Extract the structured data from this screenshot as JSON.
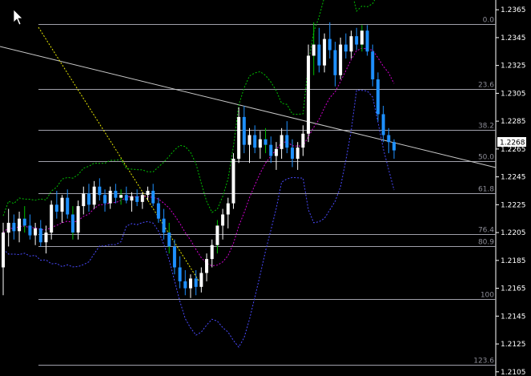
{
  "chart_data": {
    "type": "candlestick",
    "y_ticks": [
      "1.2365",
      "1.2345",
      "1.2325",
      "1.2305",
      "1.2285",
      "1.2265",
      "1.2245",
      "1.2225",
      "1.2205",
      "1.2185",
      "1.2165",
      "1.2145",
      "1.2125",
      "1.2105"
    ],
    "ylim": [
      1.2102,
      1.2372
    ],
    "current_price": "1.2268",
    "fibonacci": {
      "levels": [
        {
          "label": "0.0",
          "price": 1.2355
        },
        {
          "label": "23.6",
          "price": 1.2308
        },
        {
          "label": "38.2",
          "price": 1.2279
        },
        {
          "label": "50.0",
          "price": 1.2256
        },
        {
          "label": "61.8",
          "price": 1.2233
        },
        {
          "label": "76.4",
          "price": 1.2204
        },
        {
          "label": "80.9",
          "price": 1.2195
        },
        {
          "label": "100",
          "price": 1.2157
        },
        {
          "label": "123.6",
          "price": 1.211
        }
      ]
    },
    "candles": [
      [
        1.218,
        1.2212,
        1.216,
        1.2205
      ],
      [
        1.2205,
        1.2222,
        1.2195,
        1.2212
      ],
      [
        1.2212,
        1.2218,
        1.22,
        1.2206
      ],
      [
        1.2206,
        1.222,
        1.2198,
        1.2215
      ],
      [
        1.2215,
        1.2224,
        1.2205,
        1.221
      ],
      [
        1.221,
        1.2218,
        1.22,
        1.2203
      ],
      [
        1.2203,
        1.2212,
        1.2196,
        1.2208
      ],
      [
        1.2208,
        1.2214,
        1.2195,
        1.2198
      ],
      [
        1.2198,
        1.221,
        1.219,
        1.2205
      ],
      [
        1.2205,
        1.2228,
        1.22,
        1.2225
      ],
      [
        1.2225,
        1.2235,
        1.2215,
        1.222
      ],
      [
        1.222,
        1.2232,
        1.2212,
        1.223
      ],
      [
        1.223,
        1.2236,
        1.2215,
        1.2218
      ],
      [
        1.2218,
        1.2224,
        1.22,
        1.2205
      ],
      [
        1.2205,
        1.2228,
        1.22,
        1.2224
      ],
      [
        1.2224,
        1.2238,
        1.2218,
        1.2233
      ],
      [
        1.2233,
        1.224,
        1.222,
        1.2225
      ],
      [
        1.2225,
        1.2242,
        1.2222,
        1.2238
      ],
      [
        1.2238,
        1.2244,
        1.2228,
        1.2232
      ],
      [
        1.2232,
        1.2236,
        1.222,
        1.2226
      ],
      [
        1.2226,
        1.2238,
        1.2222,
        1.2235
      ],
      [
        1.2235,
        1.224,
        1.2226,
        1.223
      ],
      [
        1.223,
        1.2236,
        1.2225,
        1.2232
      ],
      [
        1.2232,
        1.2238,
        1.2226,
        1.2228
      ],
      [
        1.2228,
        1.2234,
        1.222,
        1.2231
      ],
      [
        1.2231,
        1.2236,
        1.2224,
        1.2227
      ],
      [
        1.2227,
        1.2234,
        1.2222,
        1.2232
      ],
      [
        1.2232,
        1.2238,
        1.2228,
        1.2235
      ],
      [
        1.2235,
        1.224,
        1.2224,
        1.2226
      ],
      [
        1.2226,
        1.223,
        1.2212,
        1.2215
      ],
      [
        1.2215,
        1.2222,
        1.22,
        1.2205
      ],
      [
        1.2205,
        1.2212,
        1.219,
        1.2195
      ],
      [
        1.2195,
        1.22,
        1.2175,
        1.218
      ],
      [
        1.218,
        1.2188,
        1.2165,
        1.217
      ],
      [
        1.217,
        1.2178,
        1.216,
        1.2165
      ],
      [
        1.2165,
        1.2175,
        1.2158,
        1.2172
      ],
      [
        1.2172,
        1.2178,
        1.216,
        1.2166
      ],
      [
        1.2166,
        1.218,
        1.2162,
        1.2176
      ],
      [
        1.2176,
        1.219,
        1.217,
        1.2186
      ],
      [
        1.2186,
        1.22,
        1.218,
        1.2196
      ],
      [
        1.2196,
        1.2214,
        1.219,
        1.221
      ],
      [
        1.221,
        1.2222,
        1.22,
        1.2218
      ],
      [
        1.2218,
        1.223,
        1.2208,
        1.2226
      ],
      [
        1.2226,
        1.2262,
        1.2222,
        1.2258
      ],
      [
        1.2258,
        1.2295,
        1.2255,
        1.2288
      ],
      [
        1.2288,
        1.2296,
        1.2262,
        1.2268
      ],
      [
        1.2268,
        1.228,
        1.2255,
        1.2275
      ],
      [
        1.2275,
        1.2282,
        1.2262,
        1.2266
      ],
      [
        1.2266,
        1.2278,
        1.2258,
        1.2272
      ],
      [
        1.2272,
        1.228,
        1.2262,
        1.2268
      ],
      [
        1.2268,
        1.2274,
        1.2255,
        1.226
      ],
      [
        1.226,
        1.227,
        1.225,
        1.2265
      ],
      [
        1.2265,
        1.228,
        1.2258,
        1.2275
      ],
      [
        1.2275,
        1.2285,
        1.2262,
        1.2266
      ],
      [
        1.2266,
        1.2272,
        1.2252,
        1.2258
      ],
      [
        1.2258,
        1.227,
        1.225,
        1.2266
      ],
      [
        1.2266,
        1.2282,
        1.226,
        1.2276
      ],
      [
        1.2276,
        1.234,
        1.227,
        1.2332
      ],
      [
        1.2332,
        1.2356,
        1.2318,
        1.234
      ],
      [
        1.234,
        1.2352,
        1.232,
        1.2325
      ],
      [
        1.2325,
        1.2348,
        1.232,
        1.2344
      ],
      [
        1.2344,
        1.2356,
        1.233,
        1.2336
      ],
      [
        1.2336,
        1.2342,
        1.231,
        1.2318
      ],
      [
        1.2318,
        1.2345,
        1.2315,
        1.234
      ],
      [
        1.234,
        1.2348,
        1.233,
        1.2335
      ],
      [
        1.2335,
        1.235,
        1.233,
        1.2346
      ],
      [
        1.2346,
        1.2352,
        1.2336,
        1.234
      ],
      [
        1.234,
        1.2354,
        1.2335,
        1.235
      ],
      [
        1.235,
        1.2354,
        1.2332,
        1.2335
      ],
      [
        1.2335,
        1.234,
        1.231,
        1.2315
      ],
      [
        1.2315,
        1.232,
        1.2285,
        1.229
      ],
      [
        1.229,
        1.2296,
        1.227,
        1.2275
      ],
      [
        1.2275,
        1.228,
        1.2262,
        1.227
      ],
      [
        1.227,
        1.2272,
        1.2258,
        1.2264
      ]
    ]
  }
}
